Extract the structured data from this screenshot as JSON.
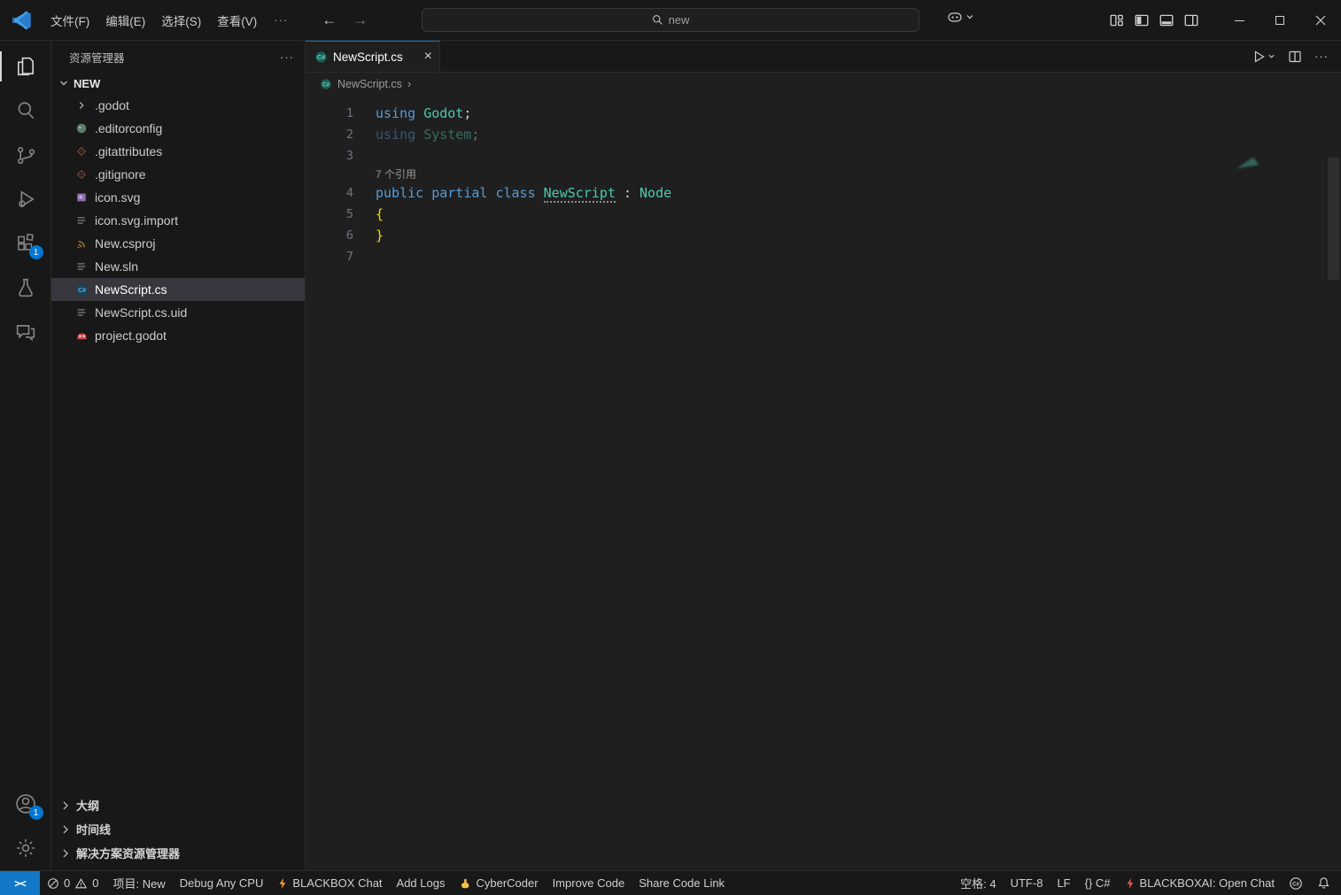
{
  "titlebar": {
    "menus": [
      "文件(F)",
      "编辑(E)",
      "选择(S)",
      "查看(V)"
    ],
    "more_label": "···",
    "back_arrow": "←",
    "forward_arrow": "→",
    "command_center_text": "new"
  },
  "activitybar": {
    "extensions_badge": "1",
    "accounts_badge": "1"
  },
  "sidebar": {
    "title": "资源管理器",
    "more_label": "···",
    "section_label": "NEW",
    "files": [
      ".godot",
      ".editorconfig",
      ".gitattributes",
      ".gitignore",
      "icon.svg",
      "icon.svg.import",
      "New.csproj",
      "New.sln",
      "NewScript.cs",
      "NewScript.cs.uid",
      "project.godot"
    ],
    "bottom_sections": [
      "大纲",
      "时间线",
      "解决方案资源管理器"
    ]
  },
  "editor": {
    "tab_label": "NewScript.cs",
    "tab_close": "×",
    "actions_more": "···",
    "breadcrumb_file": "NewScript.cs",
    "breadcrumb_sep": "›",
    "code": {
      "codelens": "7 个引用",
      "lens_before_line": 4,
      "lines": [
        {
          "num": "1",
          "tokens": [
            {
              "t": "using ",
              "c": "kw"
            },
            {
              "t": "Godot",
              "c": "type"
            },
            {
              "t": ";",
              "c": "pl"
            }
          ]
        },
        {
          "num": "2",
          "faded": true,
          "tokens": [
            {
              "t": "using ",
              "c": "kw"
            },
            {
              "t": "System",
              "c": "type"
            },
            {
              "t": ";",
              "c": "pl"
            }
          ]
        },
        {
          "num": "3",
          "tokens": []
        },
        {
          "num": "4",
          "tokens": [
            {
              "t": "public ",
              "c": "kw"
            },
            {
              "t": "partial ",
              "c": "kw"
            },
            {
              "t": "class ",
              "c": "kw"
            },
            {
              "t": "NewScript",
              "c": "type-marked"
            },
            {
              "t": " : ",
              "c": "pl"
            },
            {
              "t": "Node",
              "c": "type"
            }
          ]
        },
        {
          "num": "5",
          "tokens": [
            {
              "t": "{",
              "c": "bracket"
            }
          ]
        },
        {
          "num": "6",
          "tokens": [
            {
              "t": "}",
              "c": "bracket"
            }
          ]
        },
        {
          "num": "7",
          "tokens": []
        }
      ]
    }
  },
  "statusbar": {
    "remote_glyph": "><",
    "problems": {
      "errors": "0",
      "warnings": "0"
    },
    "project": "项目: New",
    "debug_config": "Debug Any CPU",
    "blackbox_chat": "BLACKBOX Chat",
    "add_logs": "Add Logs",
    "cybercoder": "CyberCoder",
    "improve_code": "Improve Code",
    "share_link": "Share Code Link",
    "indent": "空格: 4",
    "encoding": "UTF-8",
    "eol": "LF",
    "language": "{} C#",
    "blackboxai": "BLACKBOXAI: Open Chat"
  }
}
